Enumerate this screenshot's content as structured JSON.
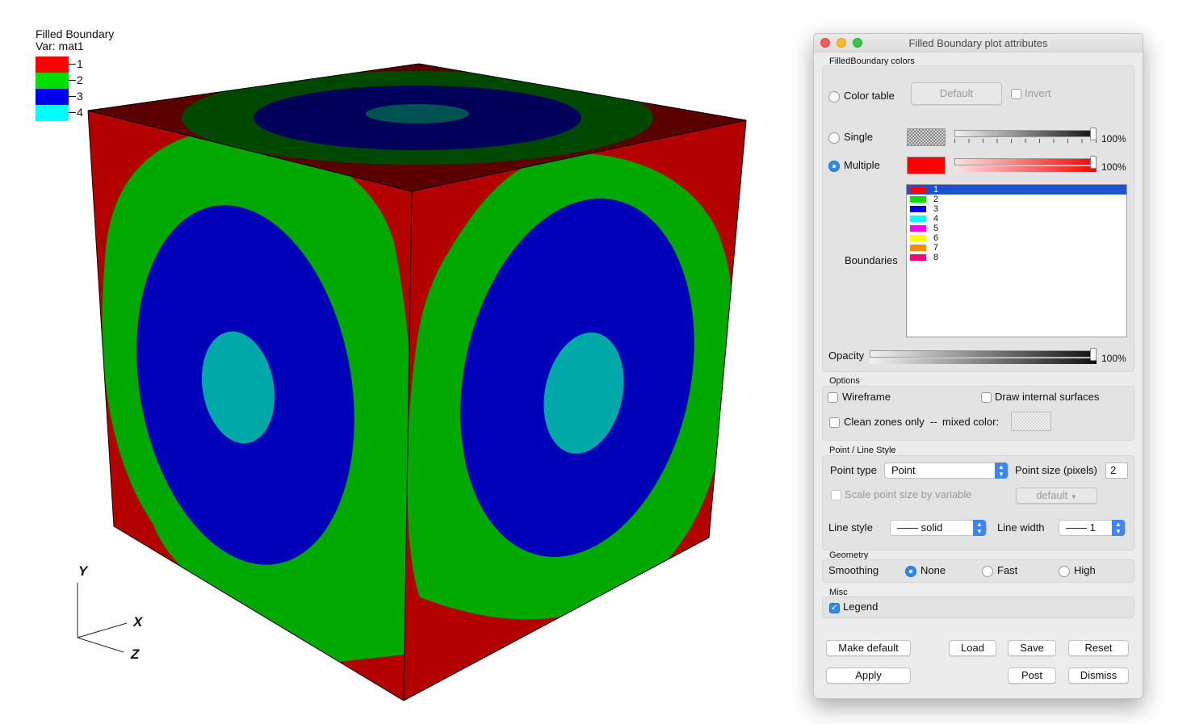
{
  "visualization": {
    "legend": {
      "title": "Filled Boundary",
      "var": "Var: mat1",
      "items": [
        {
          "label": "1",
          "color": "#ff0000"
        },
        {
          "label": "2",
          "color": "#00e000"
        },
        {
          "label": "3",
          "color": "#0000ee"
        },
        {
          "label": "4",
          "color": "#00ffff"
        }
      ]
    },
    "axes": {
      "y": "Y",
      "x": "X",
      "z": "Z"
    },
    "colors": {
      "red": "#b30000",
      "red_top": "#5a0000",
      "green": "#00a800",
      "green_top": "#004800",
      "blue": "#0000b8",
      "blue_top": "#00005a",
      "cyan": "#00a8a8",
      "cyan_top": "#005252"
    }
  },
  "window": {
    "title": "Filled Boundary plot attributes",
    "colors_group": {
      "title": "FilledBoundary colors",
      "color_table_label": "Color table",
      "color_table_button": "Default",
      "invert_label": "Invert",
      "single_label": "Single",
      "single_opacity": "100%",
      "multiple_label": "Multiple",
      "multiple_opacity": "100%",
      "multiple_color": "#ff0000",
      "selected_mode": "Multiple",
      "boundaries_label": "Boundaries",
      "boundaries": [
        {
          "label": "1",
          "color": "#ff0000"
        },
        {
          "label": "2",
          "color": "#00e000"
        },
        {
          "label": "3",
          "color": "#0000ee"
        },
        {
          "label": "4",
          "color": "#00ffff"
        },
        {
          "label": "5",
          "color": "#ff00ff"
        },
        {
          "label": "6",
          "color": "#ffff00"
        },
        {
          "label": "7",
          "color": "#ff8c00"
        },
        {
          "label": "8",
          "color": "#ff0080"
        }
      ],
      "selected_boundary": "1",
      "opacity_label": "Opacity",
      "opacity_value": "100%"
    },
    "options_group": {
      "title": "Options",
      "wireframe_label": "Wireframe",
      "draw_internal_label": "Draw internal surfaces",
      "clean_zones_label": "Clean zones only",
      "dash": "--",
      "mixed_color_label": "mixed color:"
    },
    "point_line_group": {
      "title": "Point / Line Style",
      "point_type_label": "Point type",
      "point_type_value": "Point",
      "point_size_label": "Point size (pixels)",
      "point_size_value": "2",
      "scale_point_label": "Scale point size by variable",
      "scale_var_value": "default",
      "line_style_label": "Line style",
      "line_style_value": "—— solid",
      "line_width_label": "Line width",
      "line_width_value": "—— 1"
    },
    "geometry_group": {
      "title": "Geometry",
      "smoothing_label": "Smoothing",
      "options": [
        "None",
        "Fast",
        "High"
      ],
      "selected": "None"
    },
    "misc_group": {
      "title": "Misc",
      "legend_label": "Legend",
      "legend_checked": true
    },
    "buttons": {
      "make_default": "Make default",
      "load": "Load",
      "save": "Save",
      "reset": "Reset",
      "apply": "Apply",
      "post": "Post",
      "dismiss": "Dismiss"
    }
  }
}
